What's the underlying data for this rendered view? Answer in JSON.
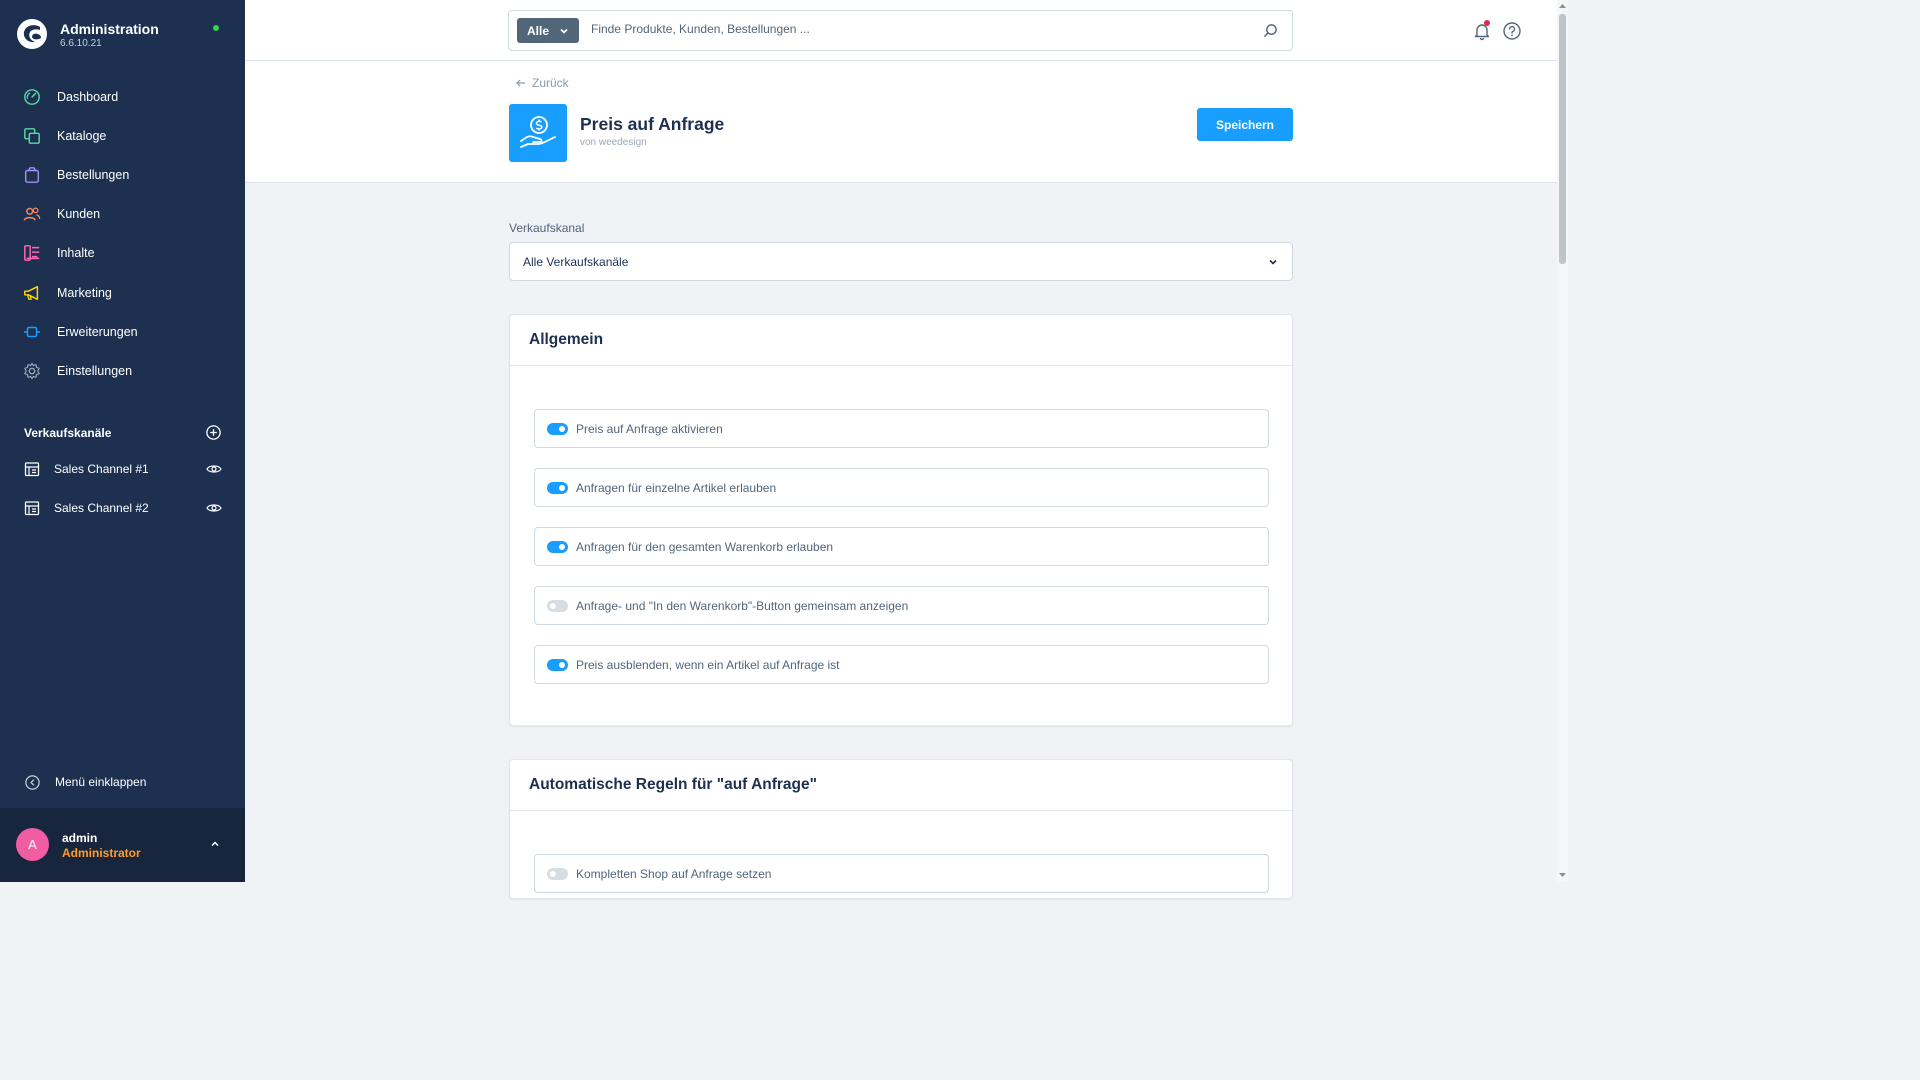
{
  "app": {
    "title": "Administration",
    "version": "6.6.10.21",
    "status_color": "#37d046",
    "logo_icon": "shopware-logo"
  },
  "sidebar": {
    "items": [
      {
        "label": "Dashboard",
        "icon": "dashboard-icon",
        "color": "#57d9a3"
      },
      {
        "label": "Kataloge",
        "icon": "catalog-icon",
        "color": "#57d9a3"
      },
      {
        "label": "Bestellungen",
        "icon": "orders-icon",
        "color": "#a092f0"
      },
      {
        "label": "Kunden",
        "icon": "customers-icon",
        "color": "#f88962"
      },
      {
        "label": "Inhalte",
        "icon": "content-icon",
        "color": "#ff68b4"
      },
      {
        "label": "Marketing",
        "icon": "marketing-icon",
        "color": "#ffd700"
      },
      {
        "label": "Erweiterungen",
        "icon": "extensions-icon",
        "color": "#189eff"
      },
      {
        "label": "Einstellungen",
        "icon": "settings-icon",
        "color": "#9aa8b5"
      }
    ],
    "sales_channels_title": "Verkaufskanäle",
    "sales_channels": [
      {
        "label": "Sales Channel #1"
      },
      {
        "label": "Sales Channel #2"
      }
    ],
    "collapse_label": "Menü einklappen",
    "user": {
      "initial": "A",
      "name": "admin",
      "role": "Administrator"
    }
  },
  "topbar": {
    "search_type": "Alle",
    "search_placeholder": "Finde Produkte, Kunden, Bestellungen ..."
  },
  "header": {
    "back_label": "Zurück",
    "title": "Preis auf Anfrage",
    "author": "von weedesign",
    "save_label": "Speichern",
    "accent_color": "#189eff"
  },
  "content": {
    "sales_channel_label": "Verkaufskanal",
    "sales_channel_value": "Alle Verkaufskanäle",
    "cards": [
      {
        "title": "Allgemein",
        "switches": [
          {
            "label": "Preis auf Anfrage aktivieren",
            "on": true
          },
          {
            "label": "Anfragen für einzelne Artikel erlauben",
            "on": true
          },
          {
            "label": "Anfragen für den gesamten Warenkorb erlauben",
            "on": true
          },
          {
            "label": "Anfrage- und \"In den Warenkorb\"-Button gemeinsam anzeigen",
            "on": false
          },
          {
            "label": "Preis ausblenden, wenn ein Artikel auf Anfrage ist",
            "on": true
          }
        ]
      },
      {
        "title": "Automatische Regeln für \"auf Anfrage\"",
        "switches": [
          {
            "label": "Kompletten Shop auf Anfrage setzen",
            "on": false
          }
        ]
      }
    ]
  }
}
